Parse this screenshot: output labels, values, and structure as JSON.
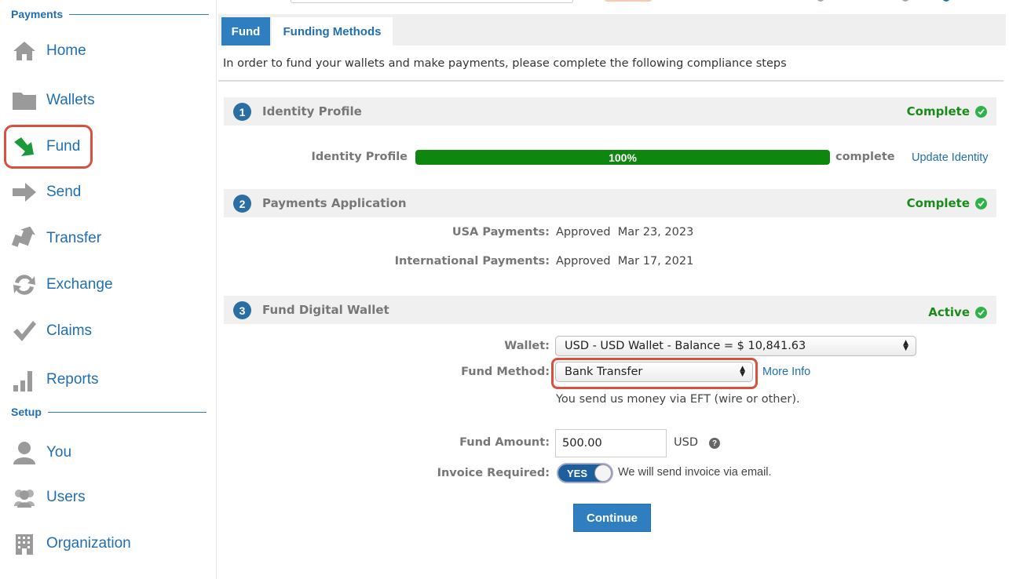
{
  "sidebar": {
    "payments_heading": "Payments",
    "setup_heading": "Setup",
    "items": [
      {
        "label": "Home"
      },
      {
        "label": "Wallets"
      },
      {
        "label": "Fund"
      },
      {
        "label": "Send"
      },
      {
        "label": "Transfer"
      },
      {
        "label": "Exchange"
      },
      {
        "label": "Claims"
      },
      {
        "label": "Reports"
      }
    ],
    "setup_items": [
      {
        "label": "You"
      },
      {
        "label": "Users"
      },
      {
        "label": "Organization"
      }
    ]
  },
  "tabs": {
    "active": "Fund",
    "other": "Funding Methods"
  },
  "intro": "In order to fund your wallets and make payments, please complete the following compliance steps",
  "steps": [
    {
      "num": "1",
      "title": "Identity Profile",
      "status": "Complete"
    },
    {
      "num": "2",
      "title": "Payments Application",
      "status": "Complete"
    },
    {
      "num": "3",
      "title": "Fund Digital Wallet",
      "status": "Active"
    }
  ],
  "identity": {
    "label": "Identity Profile",
    "progress": "100%",
    "progress_value": 100,
    "complete_word": "complete",
    "update_link": "Update Identity"
  },
  "payments_app": {
    "usa_label": "USA Payments:",
    "usa_value": "Approved  Mar 23, 2023",
    "intl_label": "International Payments:",
    "intl_value": "Approved  Mar 17, 2021"
  },
  "fund_form": {
    "wallet_label": "Wallet:",
    "wallet_value": "USD - USD Wallet - Balance = $ 10,841.63",
    "method_label": "Fund Method:",
    "method_value": "Bank Transfer",
    "more_info": "More Info",
    "method_desc": "You send us money via EFT (wire or other).",
    "amount_label": "Fund Amount:",
    "amount_value": "500.00",
    "currency": "USD",
    "invoice_label": "Invoice Required:",
    "invoice_toggle": "YES",
    "invoice_note": "We will send invoice via email.",
    "continue": "Continue"
  },
  "colors": {
    "accent": "#2f7fc0",
    "link": "#1f6fb2",
    "success": "#1a8a1a",
    "highlight": "#d9503f"
  },
  "icons": [
    "home-icon",
    "folder-icon",
    "fund-arrow-icon",
    "send-arrow-icon",
    "transfer-arrow-icon",
    "exchange-icon",
    "checkmark-icon",
    "bar-chart-icon",
    "user-icon",
    "users-icon",
    "building-icon"
  ]
}
